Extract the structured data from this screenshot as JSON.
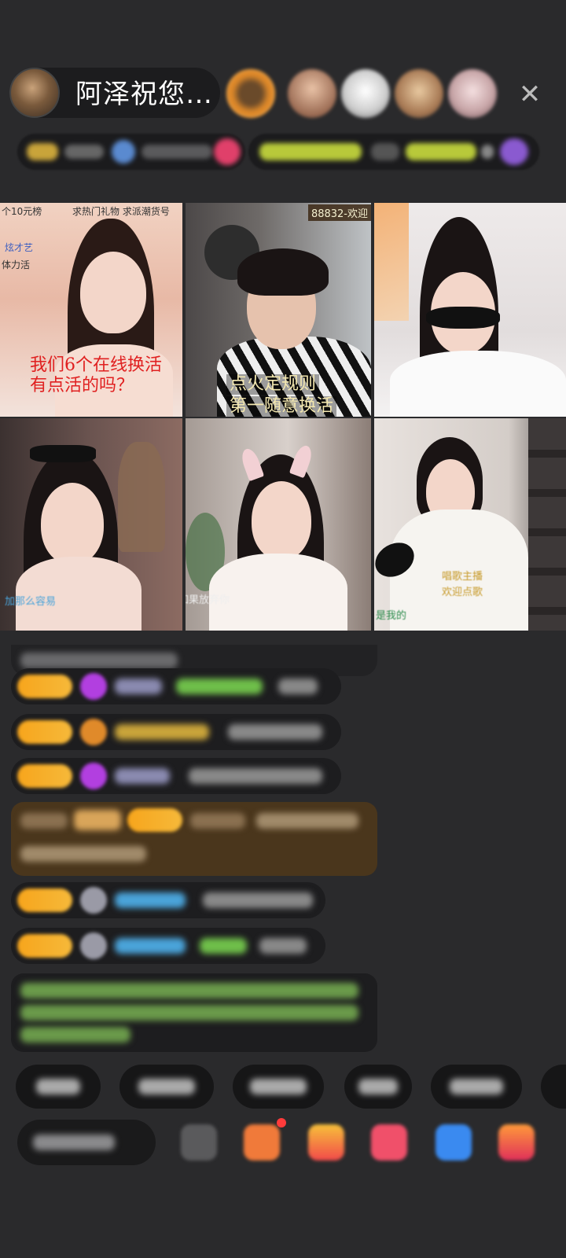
{
  "header": {
    "host_name": "阿泽祝您…",
    "close_symbol": "✕",
    "viewers": [
      {
        "name": "viewer-avatar",
        "color": "#e08a2a"
      },
      {
        "name": "viewer-avatar",
        "color": "#b7826a"
      },
      {
        "name": "viewer-avatar",
        "color": "#d9d9d9"
      },
      {
        "name": "viewer-avatar",
        "color": "#a87a55"
      },
      {
        "name": "viewer-avatar",
        "color": "#c8a6a8"
      }
    ]
  },
  "grid": {
    "tile1": {
      "top_lines": [
        "个10元榜",
        "求热门礼物 求派潮货号"
      ],
      "side_lines": [
        "炫才艺",
        "体力活"
      ],
      "caption_lines": [
        "我们6个在线换活",
        "有点活的吗？"
      ]
    },
    "tile2": {
      "top_tag": "88832-欢迎",
      "caption_lines": [
        "点火定规则",
        "第一随意换活"
      ]
    },
    "tile4": {
      "bottom_tag": "加那么容易"
    },
    "tile5": {
      "bottom_tag": "如果放弃你"
    },
    "tile6": {
      "bottom_tag": "是我的",
      "sign_lines": [
        "唱歌主播",
        "欢迎点歌"
      ]
    }
  },
  "colors": {
    "badge_gold": "#f7a51c",
    "gem_purple": "#b23fe0",
    "chat_green": "#6fbf4a",
    "chat_blue": "#4aa3d9",
    "highlight_brown": "#5a3d19"
  }
}
